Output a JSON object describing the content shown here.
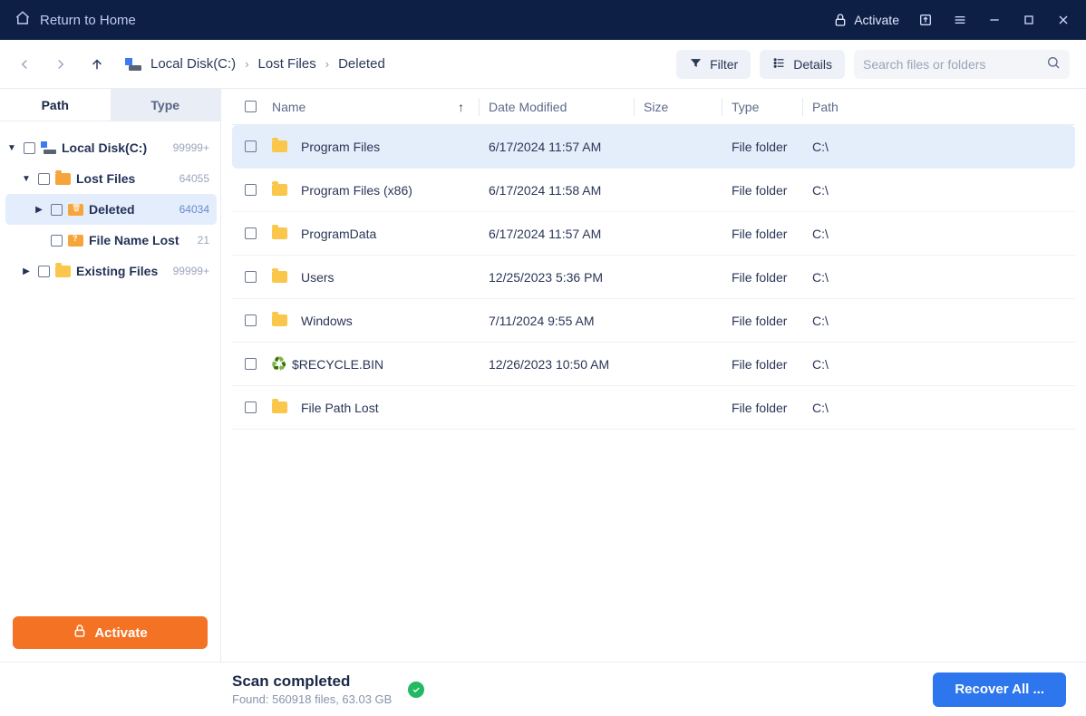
{
  "titlebar": {
    "return_label": "Return to Home",
    "activate_label": "Activate"
  },
  "toolbar": {
    "breadcrumb": [
      "Local Disk(C:)",
      "Lost Files",
      "Deleted"
    ],
    "filter_label": "Filter",
    "details_label": "Details",
    "search_placeholder": "Search files or folders"
  },
  "sidebar": {
    "tab_path": "Path",
    "tab_type": "Type",
    "nodes": {
      "root": {
        "label": "Local Disk(C:)",
        "count": "99999+"
      },
      "lost": {
        "label": "Lost Files",
        "count": "64055"
      },
      "deleted": {
        "label": "Deleted",
        "count": "64034"
      },
      "filenamelost": {
        "label": "File Name Lost",
        "count": "21"
      },
      "existing": {
        "label": "Existing Files",
        "count": "99999+"
      }
    },
    "activate_button": "Activate"
  },
  "columns": {
    "name": "Name",
    "date": "Date Modified",
    "size": "Size",
    "type": "Type",
    "path": "Path"
  },
  "rows": [
    {
      "name": "Program Files",
      "date": "6/17/2024 11:57 AM",
      "size": "",
      "type": "File folder",
      "path": "C:\\",
      "icon": "folder",
      "selected": true
    },
    {
      "name": "Program Files (x86)",
      "date": "6/17/2024 11:58 AM",
      "size": "",
      "type": "File folder",
      "path": "C:\\",
      "icon": "folder"
    },
    {
      "name": "ProgramData",
      "date": "6/17/2024 11:57 AM",
      "size": "",
      "type": "File folder",
      "path": "C:\\",
      "icon": "folder"
    },
    {
      "name": "Users",
      "date": "12/25/2023 5:36 PM",
      "size": "",
      "type": "File folder",
      "path": "C:\\",
      "icon": "folder"
    },
    {
      "name": "Windows",
      "date": "7/11/2024 9:55 AM",
      "size": "",
      "type": "File folder",
      "path": "C:\\",
      "icon": "folder"
    },
    {
      "name": "$RECYCLE.BIN",
      "date": "12/26/2023 10:50 AM",
      "size": "",
      "type": "File folder",
      "path": "C:\\",
      "icon": "recycle"
    },
    {
      "name": "File Path Lost",
      "date": "",
      "size": "",
      "type": "File folder",
      "path": "C:\\",
      "icon": "folder"
    }
  ],
  "footer": {
    "status_title": "Scan completed",
    "status_sub": "Found: 560918 files, 63.03 GB",
    "recover_label": "Recover All ..."
  }
}
